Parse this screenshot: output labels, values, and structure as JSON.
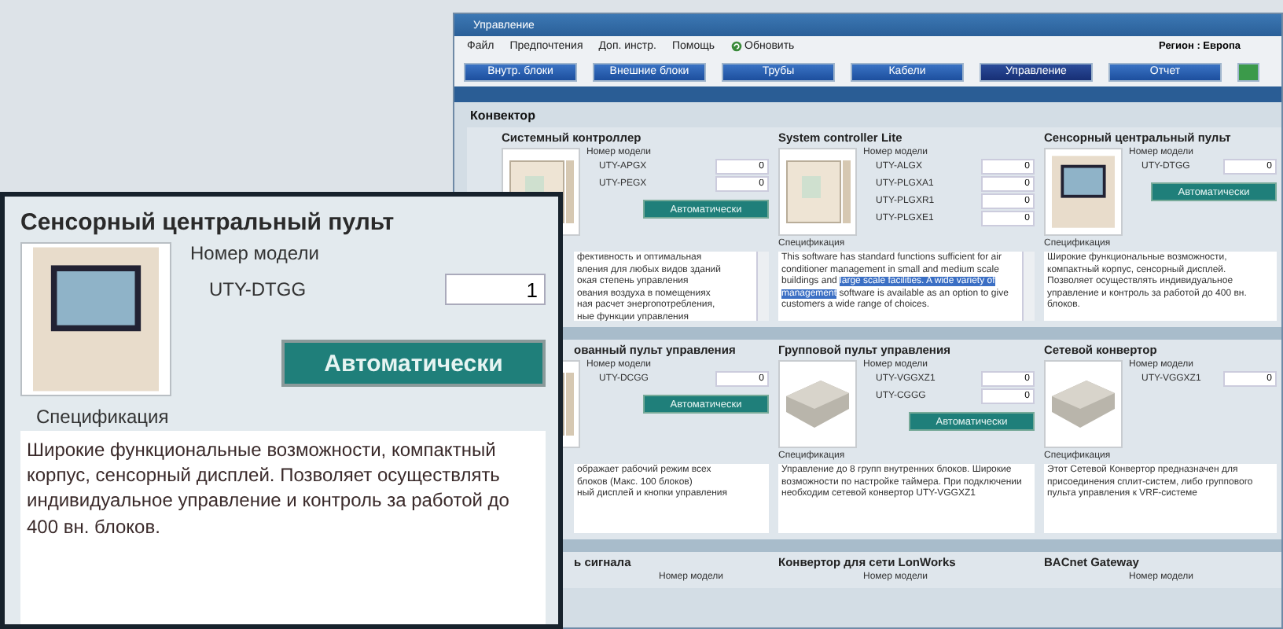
{
  "window": {
    "title": "Управление"
  },
  "menu": [
    {
      "label": "Файл",
      "kind": "text"
    },
    {
      "label": "Предпочтения",
      "kind": "text"
    },
    {
      "label": "Доп. инстр.",
      "kind": "text"
    },
    {
      "label": "Помощь",
      "kind": "text"
    },
    {
      "label": "Обновить",
      "kind": "refresh"
    }
  ],
  "region": "Регион : Европа",
  "tabs": [
    {
      "label": "Внутр. блоки",
      "selected": false
    },
    {
      "label": "Внешние блоки",
      "selected": false
    },
    {
      "label": "Трубы",
      "selected": false
    },
    {
      "label": "Кабели",
      "selected": false
    },
    {
      "label": "Управление",
      "selected": true
    },
    {
      "label": "Отчет",
      "selected": false
    }
  ],
  "section": "Конвектор",
  "rows": [
    {
      "cards": [
        {
          "title": "Системный контроллер",
          "model_label": "Номер модели",
          "models": [
            {
              "name": "UTY-APGX",
              "qty": "0"
            },
            {
              "name": "UTY-PEGX",
              "qty": "0"
            }
          ],
          "auto_button": "Автоматически",
          "spec": "фективность и оптимальная\nвления для любых видов зданий\nокая степень управления\nования воздуха в помещениях\nная расчет энергопотребления,\nные функции управления",
          "scroll": true
        },
        {
          "title": "System controller Lite",
          "model_label": "Номер модели",
          "models": [
            {
              "name": "UTY-ALGX",
              "qty": "0"
            },
            {
              "name": "UTY-PLGXA1",
              "qty": "0"
            },
            {
              "name": "UTY-PLGXR1",
              "qty": "0"
            },
            {
              "name": "UTY-PLGXE1",
              "qty": "0"
            }
          ],
          "spec_label": "Спецификация",
          "spec": "This software has standard functions sufficient for air conditioner management in small and medium scale buildings and ",
          "spec_highlight": "large scale facilities. A wide variety of management",
          "spec_after": " software is available as an option to give customers a wide range of choices.",
          "scroll": true
        },
        {
          "title": "Сенсорный центральный пульт",
          "model_label": "Номер модели",
          "models": [
            {
              "name": "UTY-DTGG",
              "qty": "0"
            }
          ],
          "auto_button": "Автоматически",
          "spec_label": "Спецификация",
          "spec": "Широкие функциональные возможности, компактный корпус, сенсорный дисплей. Позволяет осуществлять индивидуальное управление и контроль за работой до 400 вн. блоков.",
          "scroll": false
        }
      ]
    },
    {
      "cards": [
        {
          "title": "ованный пульт управления",
          "model_label": "Номер модели",
          "models": [
            {
              "name": "UTY-DCGG",
              "qty": "0"
            }
          ],
          "auto_button": "Автоматически",
          "spec": "ображает рабочий режим всех\nблоков (Макс. 100 блоков)\nный дисплей и кнопки управления",
          "scroll": false
        },
        {
          "title": "Групповой пульт управления",
          "model_label": "Номер модели",
          "models": [
            {
              "name": "UTY-VGGXZ1",
              "qty": "0"
            },
            {
              "name": "UTY-CGGG",
              "qty": "0"
            }
          ],
          "auto_button": "Автоматически",
          "spec_label": "Спецификация",
          "spec": "Управление до 8 групп внутренних блоков. Широкие возможности по настройке таймера. При подключении необходим сетевой конвертор UTY-VGGXZ1",
          "scroll": false
        },
        {
          "title": "Сетевой конвертор",
          "model_label": "Номер модели",
          "models": [
            {
              "name": "UTY-VGGXZ1",
              "qty": "0"
            }
          ],
          "spec_label": "Спецификация",
          "spec": "Этот Сетевой Конвертор предназначен для присоединения сплит-систем, либо группового пульта управления к VRF-системе",
          "scroll": false
        }
      ]
    },
    {
      "cards": [
        {
          "title": "ь сигнала",
          "model_label": "Номер модели"
        },
        {
          "title": "Конвертор для сети LonWorks",
          "model_label": "Номер модели"
        },
        {
          "title": "BACnet Gateway",
          "model_label": "Номер модели"
        }
      ]
    }
  ],
  "inset": {
    "title": "Сенсорный центральный пульт",
    "model_label": "Номер модели",
    "model": "UTY-DTGG",
    "quantity": "1",
    "auto_button": "Автоматически",
    "spec_label": "Спецификация",
    "spec": "Широкие функциональные возможности, компактный корпус, сенсорный дисплей. Позволяет осуществлять индивидуальное управление и контроль за работой до 400 вн. блоков."
  }
}
